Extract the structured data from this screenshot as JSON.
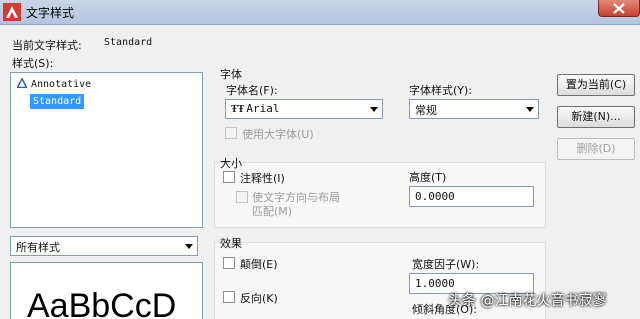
{
  "window": {
    "title": "文字样式"
  },
  "current_style": {
    "label": "当前文字样式:",
    "value": "Standard"
  },
  "styles": {
    "label": "样式(S):",
    "items": [
      {
        "name": "Annotative"
      },
      {
        "name": "Standard"
      }
    ],
    "selected": "Standard",
    "filter_value": "所有样式"
  },
  "font": {
    "group_label": "字体",
    "name_label": "字体名(F):",
    "name_value": "Arial",
    "style_label": "字体样式(Y):",
    "style_value": "常规",
    "bigfont_label": "使用大字体(U)",
    "bigfont_icon": "truetype-font-icon"
  },
  "size": {
    "group_label": "大小",
    "annotative_label": "注释性(I)",
    "match_orientation_line1": "使文字方向与布局",
    "match_orientation_line2": "匹配(M)",
    "height_label": "高度(T)",
    "height_value": "0.0000"
  },
  "effects": {
    "group_label": "效果",
    "upside_down_label": "颠倒(E)",
    "backwards_label": "反向(K)",
    "width_factor_label": "宽度因子(W):",
    "width_factor_value": "1.0000",
    "oblique_label": "倾斜角度(O):"
  },
  "buttons": {
    "set_current": "置为当前(C)",
    "new": "新建(N)...",
    "delete": "删除(D)"
  },
  "preview": {
    "text": "AaBbCcD"
  },
  "watermark": "头条 @江南花火音书寂寥",
  "colors": {
    "selection": "#3399ff",
    "close": "#c8402e",
    "title_bg": "#c9d6e8"
  }
}
